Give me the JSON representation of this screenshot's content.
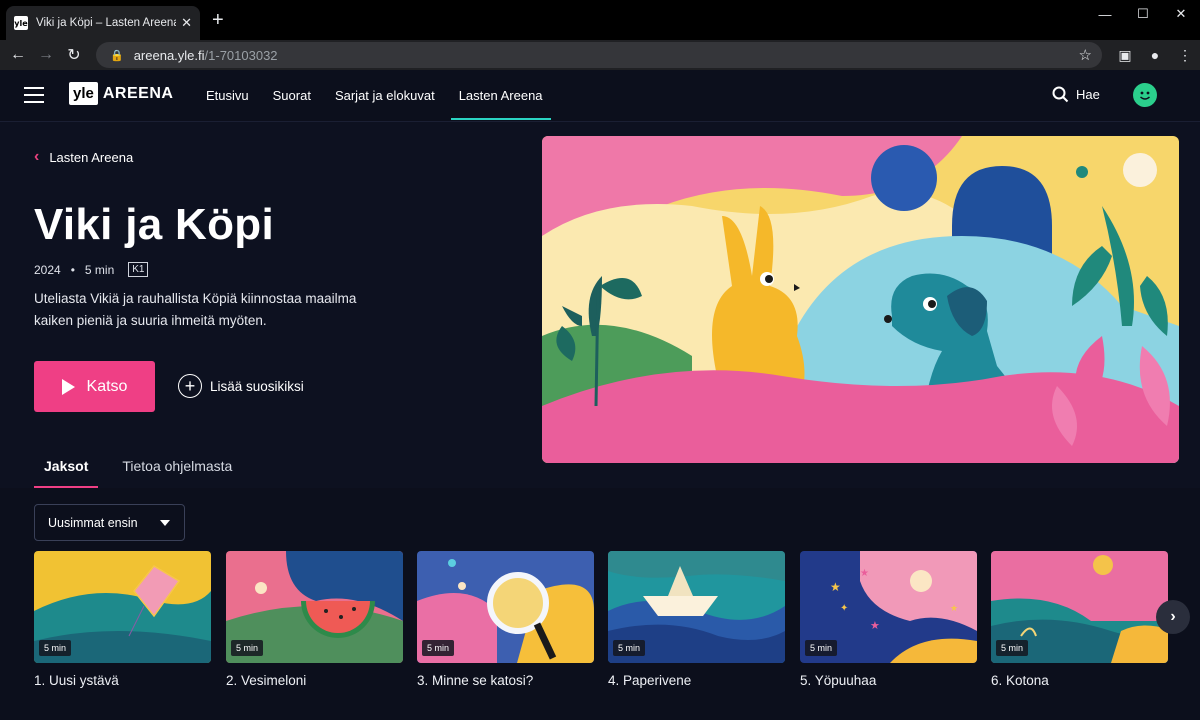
{
  "browser": {
    "tab_title": "Viki ja Köpi – Lasten Areena – Yle",
    "favicon_text": "yle",
    "url_host": "areena.yle.fi",
    "url_path": "/1-70103032"
  },
  "header": {
    "logo_yle": "yle",
    "logo_areena": "AREENA",
    "nav": [
      {
        "label": "Etusivu"
      },
      {
        "label": "Suorat"
      },
      {
        "label": "Sarjat ja elokuvat"
      },
      {
        "label": "Lasten Areena",
        "active": true
      }
    ],
    "search_label": "Hae",
    "accent_color": "#2bd4c3"
  },
  "hero": {
    "back_label": "Lasten Areena",
    "title": "Viki ja Köpi",
    "year": "2024",
    "duration": "5 min",
    "age_rating": "K1",
    "description": "Uteliasta Vikiä ja rauhallista Köpiä kiinnostaa maailma kaiken pieniä ja suuria ihmeitä myöten.",
    "play_label": "Katso",
    "favorite_label": "Lisää suosikiksi",
    "play_color": "#ef3f85"
  },
  "tabs": [
    {
      "label": "Jaksot",
      "active": true
    },
    {
      "label": "Tietoa ohjelmasta"
    }
  ],
  "episodes": {
    "sort_label": "Uusimmat ensin",
    "items": [
      {
        "title": "1. Uusi ystävä",
        "duration": "5 min"
      },
      {
        "title": "2. Vesimeloni",
        "duration": "5 min"
      },
      {
        "title": "3. Minne se katosi?",
        "duration": "5 min"
      },
      {
        "title": "4. Paperivene",
        "duration": "5 min"
      },
      {
        "title": "5. Yöpuuhaa",
        "duration": "5 min"
      },
      {
        "title": "6. Kotona",
        "duration": "5 min"
      }
    ]
  }
}
